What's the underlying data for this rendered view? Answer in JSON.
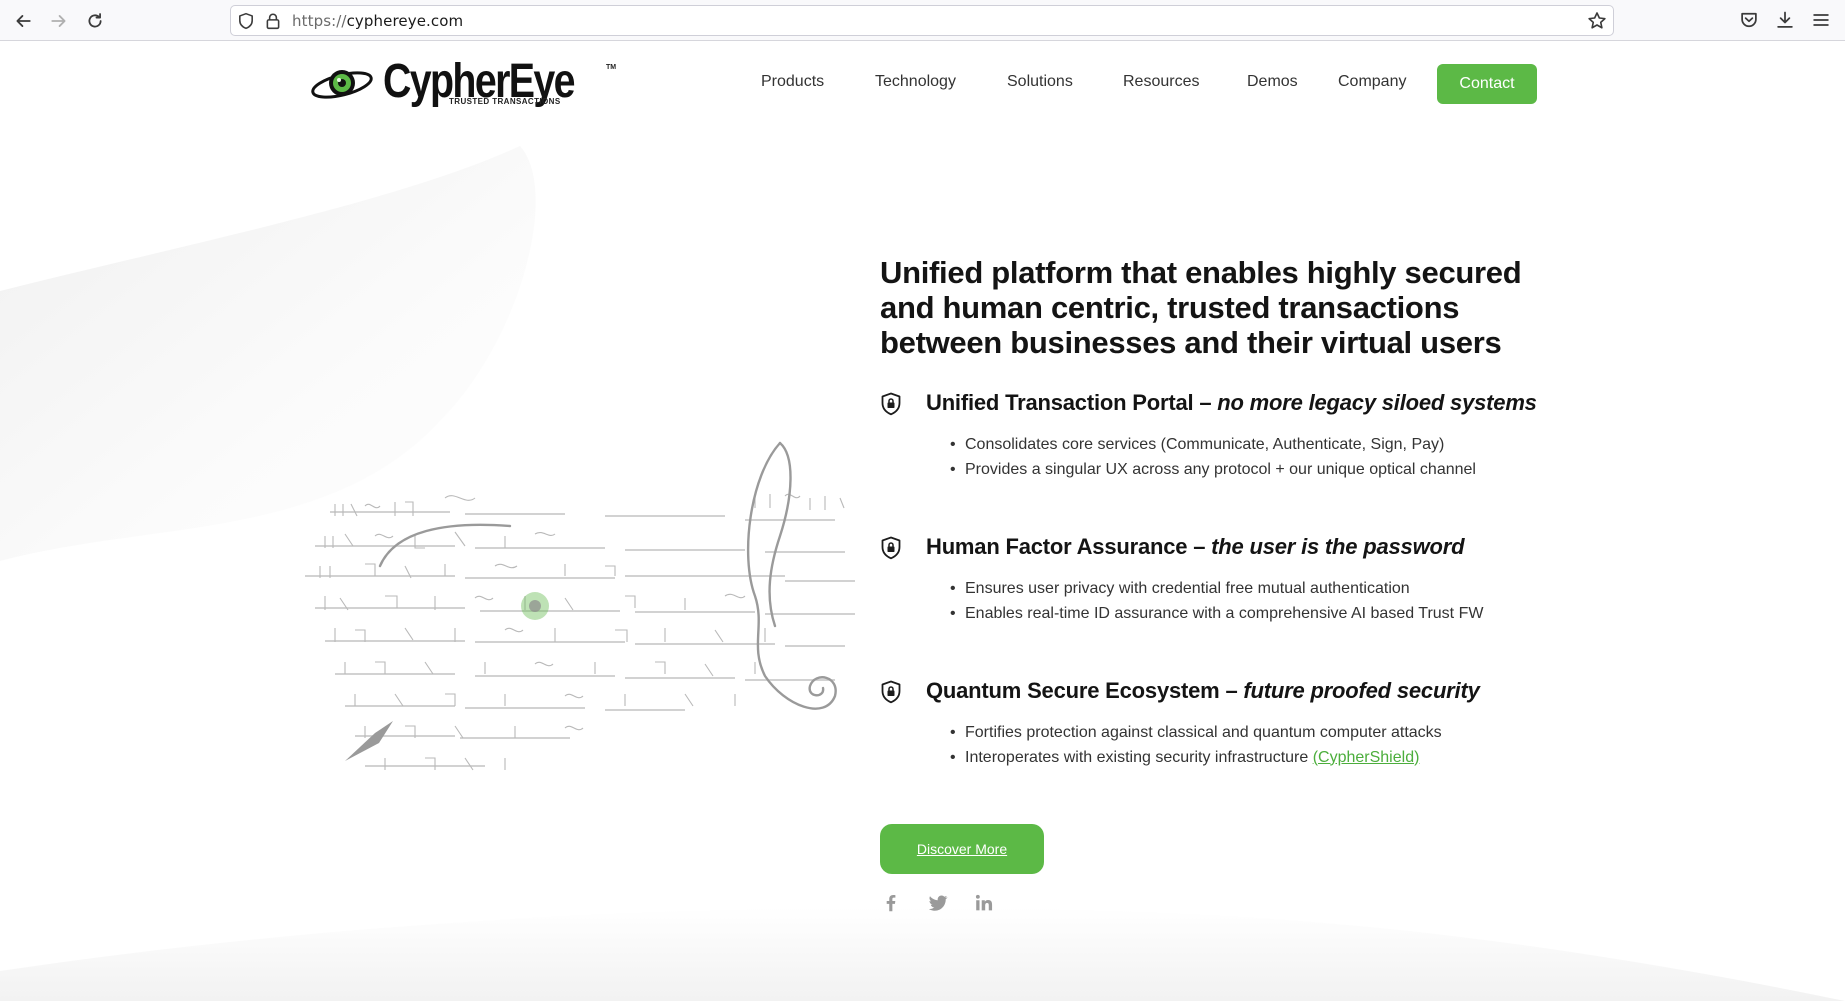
{
  "browser": {
    "url_protocol": "https://",
    "url_host": "cyphereye.com"
  },
  "logo": {
    "name_part1": "Cypher",
    "name_part2": "Eye",
    "tagline": "TRUSTED TRANSACTIONS",
    "trademark": "TM"
  },
  "nav": {
    "items": [
      "Products",
      "Technology",
      "Solutions",
      "Resources",
      "Demos",
      "Company"
    ],
    "contact_label": "Contact"
  },
  "hero": {
    "headline": "Unified platform that enables highly secured and human centric, trusted transactions between businesses and their virtual users",
    "features": [
      {
        "title": "Unified Transaction Portal – ",
        "title_emphasis": "no more legacy siloed systems",
        "bullets": [
          "Consolidates core services (Communicate, Authenticate, Sign, Pay)",
          "Provides a singular UX across any protocol + our unique optical channel"
        ]
      },
      {
        "title": "Human Factor Assurance – ",
        "title_emphasis": "the user is the password",
        "bullets": [
          "Ensures user privacy with credential free mutual authentication",
          "Enables real-time ID assurance with a comprehensive AI based Trust FW"
        ]
      },
      {
        "title": "Quantum Secure Ecosystem – ",
        "title_emphasis": "future proofed security",
        "bullets": [
          "Fortifies protection against classical and quantum computer attacks",
          "Interoperates with existing security infrastructure "
        ],
        "link_text": "(CypherShield)"
      }
    ],
    "cta_label": "Discover More"
  },
  "social": [
    "facebook-icon",
    "twitter-icon",
    "linkedin-icon"
  ],
  "colors": {
    "accent_green": "#5cb946",
    "link_green": "#4cae3c",
    "heading": "#141414"
  }
}
